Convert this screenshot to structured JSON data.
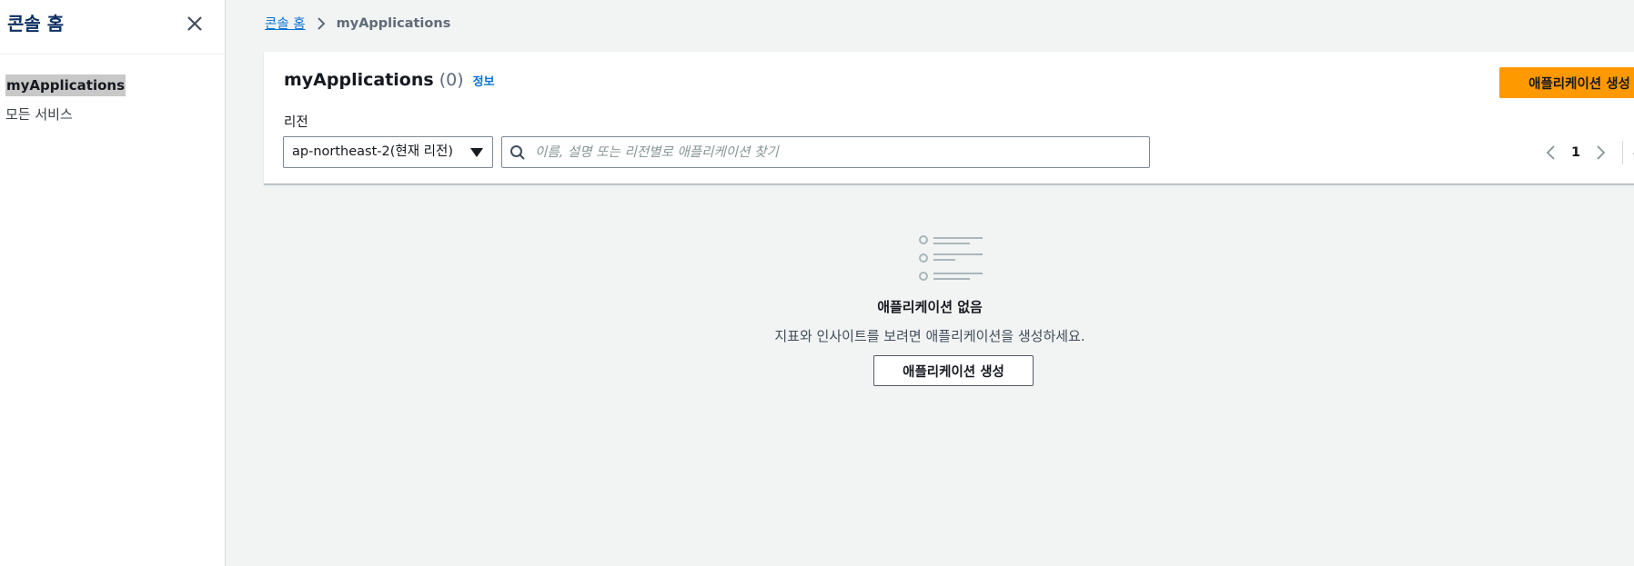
{
  "sidebar": {
    "title": "콘솔 홈",
    "items": [
      {
        "label": "myApplications",
        "active": true
      },
      {
        "label": "모든 서비스",
        "active": false
      }
    ]
  },
  "breadcrumb": {
    "home": "콘솔 홈",
    "current": "myApplications"
  },
  "panel": {
    "title": "myApplications",
    "count": "(0)",
    "info": "정보",
    "create_button": "애플리케이션 생성",
    "region_label": "리전",
    "region_value": "ap-northeast-2(현재 리전)",
    "search_placeholder": "이름, 설명 또는 리전별로 애플리케이션 찾기",
    "page_number": "1"
  },
  "empty_state": {
    "title": "애플리케이션 없음",
    "description": "지표와 인사이트를 보려면 애플리케이션을 생성하세요.",
    "button": "애플리케이션 생성"
  },
  "colors": {
    "primary_button": "#ff9900",
    "link": "#0972d3",
    "background": "#f2f3f3"
  },
  "icons": [
    "close-icon",
    "chevron-right-icon",
    "search-icon",
    "chevron-left-icon",
    "settings-icon",
    "empty-list-icon"
  ]
}
